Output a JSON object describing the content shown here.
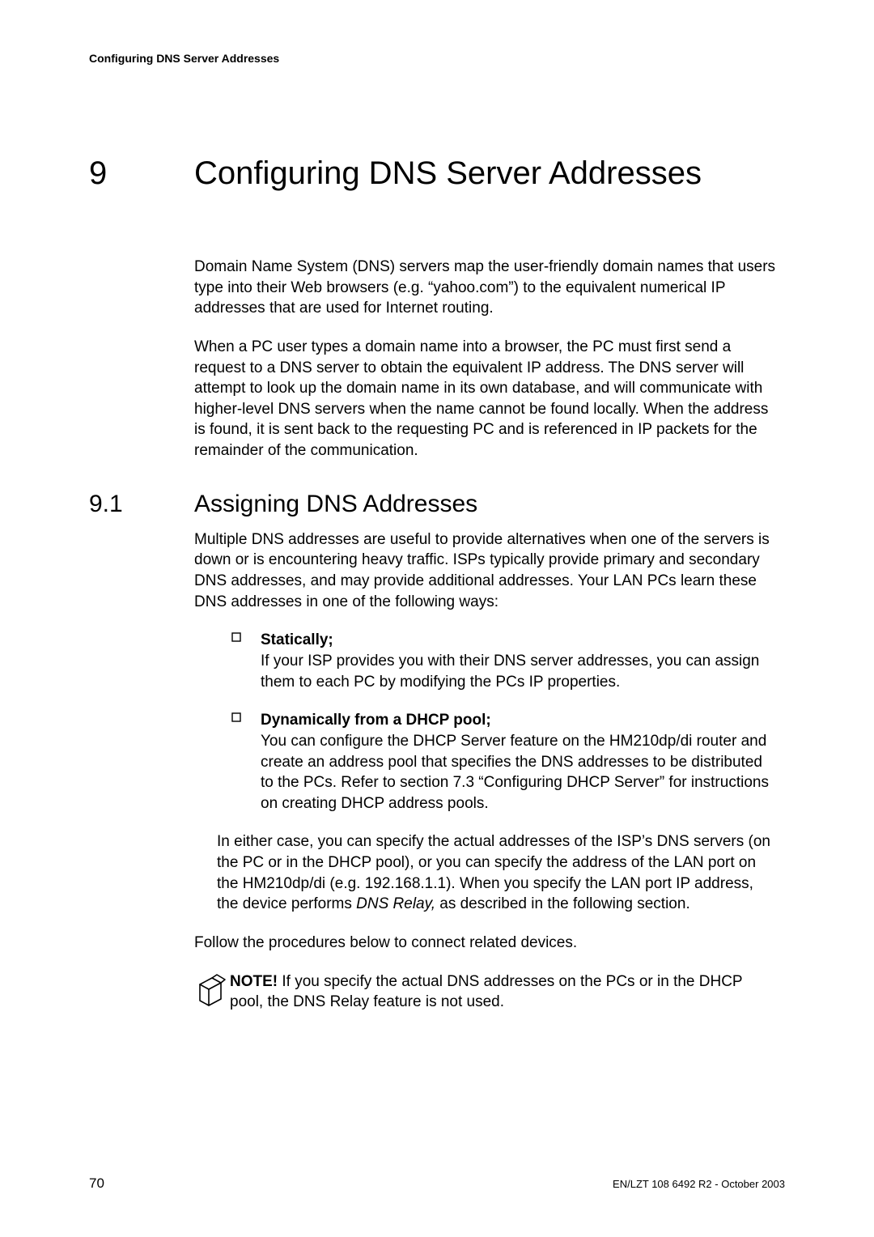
{
  "header": {
    "running_title": "Configuring DNS Server Addresses"
  },
  "chapter": {
    "number": "9",
    "title": "Configuring DNS Server Addresses"
  },
  "intro": {
    "p1": "Domain Name System (DNS) servers map the user-friendly domain names that users type into their Web browsers (e.g. “yahoo.com”) to the equivalent numerical IP addresses that are used for Internet routing.",
    "p2": "When a PC user types a domain name into a browser, the PC must first send a request to a DNS server to obtain the equivalent IP address. The DNS server will attempt to look up the domain name in its own database, and will communicate with higher-level DNS servers when the name cannot be found locally. When the address is found, it is sent back to the requesting PC and is referenced in IP packets for the remainder of the communication."
  },
  "section": {
    "number": "9.1",
    "title": "Assigning DNS Addresses"
  },
  "section_body": {
    "p1": "Multiple DNS addresses are useful to provide alternatives when one of the servers is down or is encountering heavy traffic. ISPs typically provide primary and secondary DNS addresses, and may provide additional addresses. Your LAN PCs learn these DNS addresses in one of the following ways:",
    "bullets": [
      {
        "head": "Statically;",
        "body": "If your ISP provides you with their DNS server addresses, you can assign them to each PC by modifying the PCs IP properties."
      },
      {
        "head": "Dynamically from a DHCP pool;",
        "body": "You can configure the DHCP Server feature on the HM210dp/di router and create an address pool that specifies the DNS addresses to be distributed to the PCs. Refer to section 7.3 “Configuring DHCP Server” for instructions on creating DHCP address pools."
      }
    ],
    "p2_pre": "In either case, you can specify the actual addresses of the ISP’s DNS servers (on the PC or in the DHCP pool), or you can specify the address of the LAN port on the HM210dp/di (e.g. 192.168.1.1). When you specify the LAN port IP address, the device performs ",
    "p2_em": "DNS Relay,",
    "p2_post": " as described in the following section.",
    "p3": "Follow the procedures below to connect related devices.",
    "note_bold": "NOTE!",
    "note_rest": " If you specify the actual DNS addresses on the PCs or in the DHCP pool, the DNS Relay feature is not used."
  },
  "footer": {
    "page": "70",
    "right": "EN/LZT 108 6492 R2  - October 2003"
  }
}
